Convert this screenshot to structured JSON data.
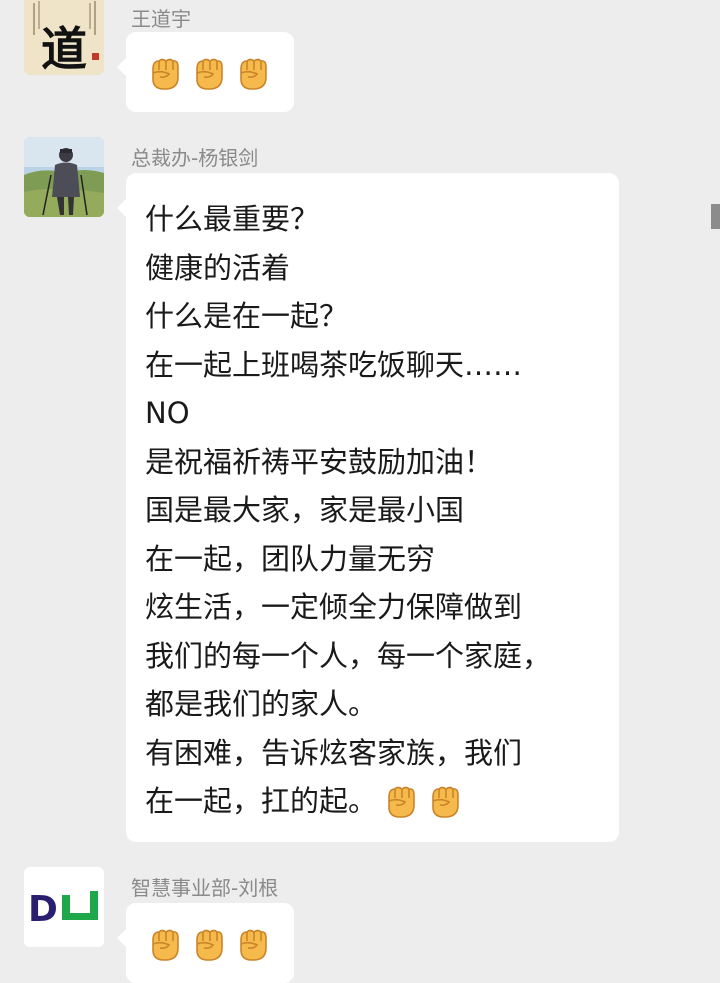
{
  "messages": [
    {
      "sender": "王道宇",
      "avatar": {
        "glyph": "道",
        "icon": "calligraphy-avatar"
      },
      "emoji": [
        "fist-icon",
        "fist-icon",
        "fist-icon"
      ]
    },
    {
      "sender": "总裁办-杨银剑",
      "avatar": {
        "icon": "hiker-photo-avatar"
      },
      "lines": [
        "什么最重要？",
        "健康的活着",
        "什么是在一起？",
        "在一起上班喝茶吃饭聊天……",
        "NO",
        "是祝福祈祷平安鼓励加油！",
        "国是最大家，家是最小国",
        "在一起，团队力量无穷",
        "炫生活，一定倾全力保障做到",
        "我们的每一个人，每一个家庭，",
        "都是我们的家人。",
        "有困难，告诉炫客家族，我们",
        "在一起，扛的起。"
      ],
      "trailing_emoji": [
        "fist-icon",
        "fist-icon"
      ]
    },
    {
      "sender": "智慧事业部-刘根",
      "avatar": {
        "logo_text": "DL",
        "icon": "dl-logo-avatar"
      },
      "emoji": [
        "fist-icon",
        "fist-icon",
        "fist-icon"
      ]
    }
  ],
  "colors": {
    "background": "#ededed",
    "bubble": "#ffffff",
    "sender_name": "#8a8a8a",
    "logo_purple": "#2a1e6e",
    "logo_green": "#1fa84a",
    "fist": "#f6b94c"
  }
}
